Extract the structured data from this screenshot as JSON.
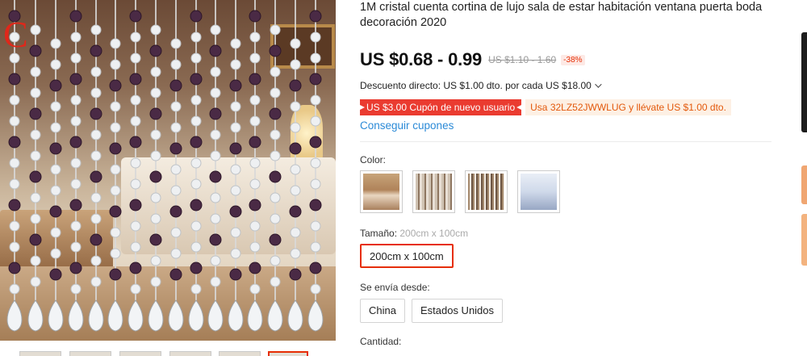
{
  "product": {
    "title": "1M cristal cuenta cortina de lujo sala de estar habitación ventana puerta boda decoración 2020",
    "price": "US $0.68 - 0.99",
    "original_price": "US $1.10 - 1.60",
    "discount_badge": "-38%",
    "direct_discount": "Descuento directo: US $1.00 dto. por cada US $18.00",
    "coupon_new_user": "US $3.00 Cupón de nuevo usuario",
    "coupon_code": "Usa 32LZ52JWWLUG y llévate US $1.00 dto.",
    "get_coupons": "Conseguir cupones"
  },
  "gallery": {
    "brand_letter": "C"
  },
  "color": {
    "label": "Color:",
    "option_count_visible": 4
  },
  "size": {
    "label": "Tamaño:",
    "selected_value": "200cm x 100cm",
    "options": [
      "200cm x 100cm"
    ]
  },
  "shipping": {
    "label": "Se envía desde:",
    "options": [
      "China",
      "Estados Unidos"
    ]
  },
  "quantity": {
    "label": "Cantidad:"
  },
  "colors": {
    "price_accent": "#e62e04",
    "link": "#2b8ad7",
    "coupon_red": "#ea3b30",
    "coupon_orange_text": "#e3590c"
  }
}
